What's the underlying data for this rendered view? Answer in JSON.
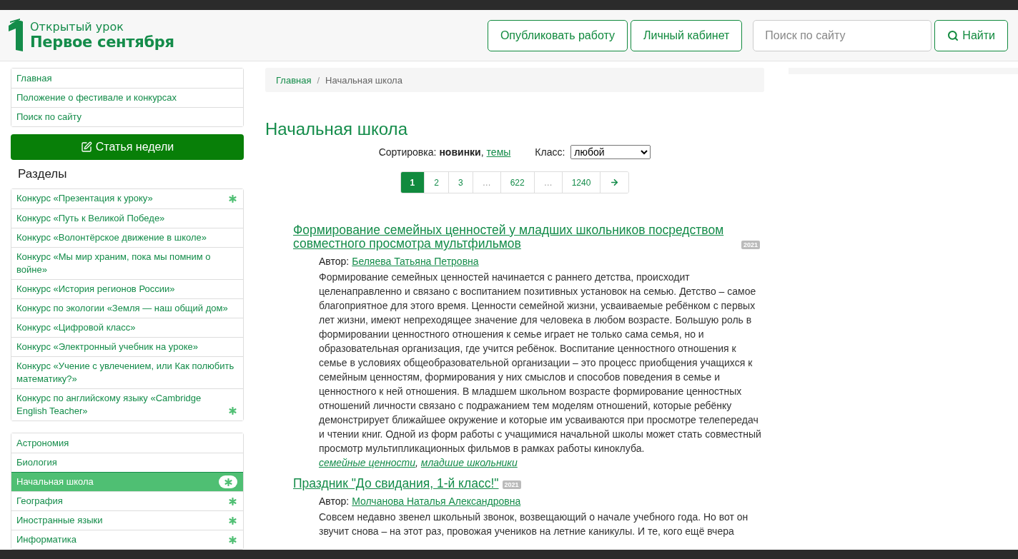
{
  "header": {
    "logo_top": "Открытый урок",
    "logo_bottom": "Первое сентября",
    "buttons": [
      "Опубликовать работу",
      "Личный кабинет"
    ],
    "search": {
      "placeholder": "Поиск по сайту"
    },
    "search_button": "Найти"
  },
  "sidebar": {
    "top_links": [
      "Главная",
      "Положение о фестивале и конкурсах",
      "Поиск по сайту"
    ],
    "feature_button": "Статья недели",
    "sections_title": "Разделы",
    "contests": [
      {
        "label": "Конкурс «Презентация к уроку»",
        "has_new": true
      },
      {
        "label": "Конкурс «Путь к Великой Победе»",
        "has_new": false
      },
      {
        "label": "Конкурс «Волонтёрское движение в школе»",
        "has_new": false
      },
      {
        "label": "Конкурс «Мы мир храним, пока мы помним о войне»",
        "has_new": false
      },
      {
        "label": "Конкурс «История регионов России»",
        "has_new": false
      },
      {
        "label": "Конкурс по экологии «Земля — наш общий дом»",
        "has_new": false
      },
      {
        "label": "Конкурс «Цифровой класс»",
        "has_new": false
      },
      {
        "label": "Конкурс «Электронный учебник на уроке»",
        "has_new": false
      },
      {
        "label": "Конкурс «Учение с увлечением, или Как полюбить математику?»",
        "has_new": false
      },
      {
        "label": "Конкурс по английскому языку «Cambridge English Teacher»",
        "has_new": true
      }
    ],
    "subjects": [
      {
        "label": "Астрономия",
        "has_new": false,
        "selected": false
      },
      {
        "label": "Биология",
        "has_new": false,
        "selected": false
      },
      {
        "label": "Начальная школа",
        "has_new": true,
        "selected": true
      },
      {
        "label": "География",
        "has_new": true,
        "selected": false
      },
      {
        "label": "Иностранные языки",
        "has_new": true,
        "selected": false
      },
      {
        "label": "Информатика",
        "has_new": true,
        "selected": false
      }
    ]
  },
  "breadcrumb": [
    "Главная",
    "Начальная школа"
  ],
  "breadcrumb_separator": "/",
  "list_separator": ",",
  "page_title": "Начальная школа",
  "sort": {
    "label": "Сортировка:",
    "options": [
      {
        "label": "новинки",
        "selected": true
      },
      {
        "label": "темы",
        "selected": false
      }
    ]
  },
  "class_filter": {
    "label": "Класс:",
    "value": "любой"
  },
  "pagination": [
    {
      "kind": "page",
      "label": "1",
      "selected": true
    },
    {
      "kind": "page",
      "label": "2",
      "selected": false
    },
    {
      "kind": "page",
      "label": "3",
      "selected": false
    },
    {
      "kind": "ellipsis",
      "label": "…",
      "selected": false
    },
    {
      "kind": "page",
      "label": "622",
      "selected": false
    },
    {
      "kind": "ellipsis",
      "label": "…",
      "selected": false
    },
    {
      "kind": "page",
      "label": "1240",
      "selected": false
    },
    {
      "kind": "next",
      "selected": false
    }
  ],
  "articles": [
    {
      "title": "Формирование семейных ценностей у младших школьников посредством совместного просмотра мультфильмов",
      "year": "2021",
      "author_label": "Автор:",
      "author": "Беляева Татьяна Петровна",
      "summary": "Формирование семейных ценностей начинается с раннего детства, происходит целенаправленно и связано с воспитанием позитивных установок на семью. Детство – самое благоприятное для этого время. Ценности семейной жизни, усваиваемые ребёнком с первых лет жизни, имеют непреходящее значение для человека в любом возрасте. Большую роль в формировании ценностного отношения к семье играет не только сама семья, но и образовательная организация, где учится ребёнок. Воспитание ценностного отношения к семье в условиях общеобразовательной организации – это процесс приобщения учащихся к семейным ценностям, формирования у них смыслов и способов поведения в семье и ценностного к ней отношения. В младшем школьном возрасте формирование ценностных отношений личности связано с подражанием тем моделям отношений, которые ребёнку демонстрирует ближайшее окружение и которые им усваиваются при просмотре телепередач и чтении книг. Одной из форм работы с учащимися начальной школы может стать совместный просмотр мультипликационных фильмов в рамках работы киноклуба.",
      "tags": [
        "семейные ценности",
        "младшие школьники"
      ]
    },
    {
      "title": "Праздник \"До свидания, 1-й класс!\"",
      "year": "2021",
      "author_label": "Автор:",
      "author": "Молчанова Наталья Александровна",
      "summary": "Совсем недавно звенел школьный звонок, возвещающий о начале учебного года. Но вот он звучит снова – на этот раз, провожая учеников на летние каникулы. И те, кого ещё вчера"
    }
  ]
}
